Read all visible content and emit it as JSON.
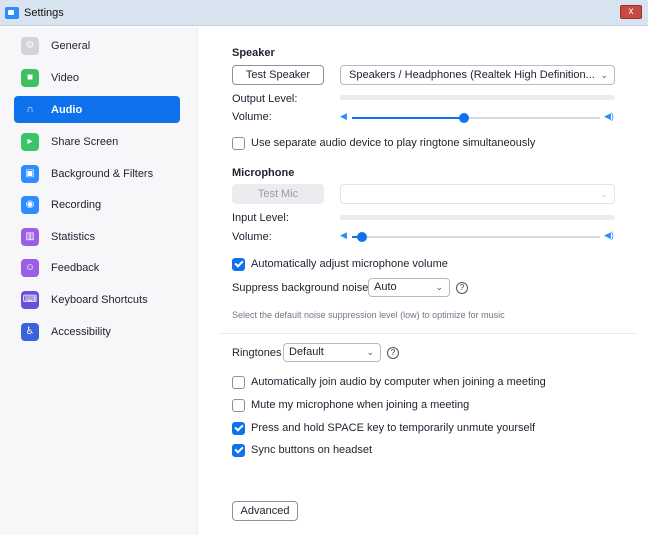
{
  "window": {
    "title": "Settings",
    "close_glyph": "x"
  },
  "sidebar": {
    "items": [
      {
        "label": "General",
        "icon": "gear-icon",
        "color": "#d3d3d8"
      },
      {
        "label": "Video",
        "icon": "video-camera-icon",
        "color": "#40c060"
      },
      {
        "label": "Audio",
        "icon": "headphones-icon",
        "color": "#0e72ed",
        "active": true
      },
      {
        "label": "Share Screen",
        "icon": "share-screen-icon",
        "color": "#3cc46b"
      },
      {
        "label": "Background & Filters",
        "icon": "background-icon",
        "color": "#2d8cff"
      },
      {
        "label": "Recording",
        "icon": "record-icon",
        "color": "#2d8cff"
      },
      {
        "label": "Statistics",
        "icon": "statistics-icon",
        "color": "#9b5de5"
      },
      {
        "label": "Feedback",
        "icon": "feedback-icon",
        "color": "#9b5de5"
      },
      {
        "label": "Keyboard Shortcuts",
        "icon": "keyboard-icon",
        "color": "#6a4fd6"
      },
      {
        "label": "Accessibility",
        "icon": "accessibility-icon",
        "color": "#3b62d6"
      }
    ]
  },
  "speaker": {
    "title": "Speaker",
    "test_button": "Test Speaker",
    "device": "Speakers / Headphones (Realtek High Definition...",
    "output_level_label": "Output Level:",
    "volume_label": "Volume:",
    "volume_level": 0.45,
    "separate_device_label": "Use separate audio device to play ringtone simultaneously",
    "separate_device_checked": false
  },
  "microphone": {
    "title": "Microphone",
    "test_button": "Test Mic",
    "device": "",
    "input_level_label": "Input Level:",
    "volume_label": "Volume:",
    "volume_level": 0.04,
    "auto_adjust_label": "Automatically adjust microphone volume",
    "auto_adjust_checked": true,
    "suppress_label": "Suppress background noise",
    "suppress_value": "Auto",
    "suppress_hint": "Select the default noise suppression level (low) to optimize for music"
  },
  "ringtones": {
    "label": "Ringtones",
    "value": "Default"
  },
  "options": [
    {
      "label": "Automatically join audio by computer when joining a meeting",
      "checked": false
    },
    {
      "label": "Mute my microphone when joining a meeting",
      "checked": false
    },
    {
      "label": "Press and hold SPACE key to temporarily unmute yourself",
      "checked": true
    },
    {
      "label": "Sync buttons on headset",
      "checked": true
    }
  ],
  "advanced_button": "Advanced",
  "glyphs": {
    "chevron": "⌄",
    "help": "?",
    "vol_low": "◀",
    "vol_high": "◀)"
  },
  "colors": {
    "accent": "#0e72ed"
  }
}
